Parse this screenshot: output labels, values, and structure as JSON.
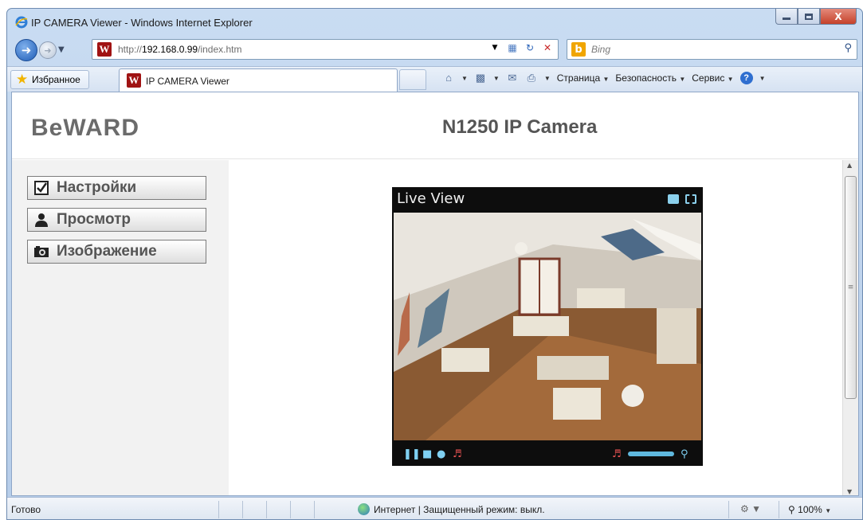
{
  "window": {
    "title": "IP CAMERA Viewer - Windows Internet Explorer",
    "close_label": "X"
  },
  "navbar": {
    "url_prefix": "http://",
    "url_host": "192.168.0.99",
    "url_path": "/index.htm",
    "search_placeholder": "Bing"
  },
  "favbar": {
    "favorites_label": "Избранное",
    "tab_label": "IP CAMERA Viewer",
    "commands": {
      "page": "Страница",
      "safety": "Безопасность",
      "tools": "Сервис"
    }
  },
  "page": {
    "logo": "BeWARD",
    "camera_title": "N1250 IP Camera",
    "menu": [
      {
        "label": "Настройки",
        "icon": "checkbox-icon"
      },
      {
        "label": "Просмотр",
        "icon": "user-icon"
      },
      {
        "label": "Изображение",
        "icon": "camera-icon"
      }
    ],
    "live_view": {
      "title": "Live View"
    }
  },
  "statusbar": {
    "status": "Готово",
    "zone": "Интернет | Защищенный режим: выкл.",
    "zoom": "100%"
  }
}
